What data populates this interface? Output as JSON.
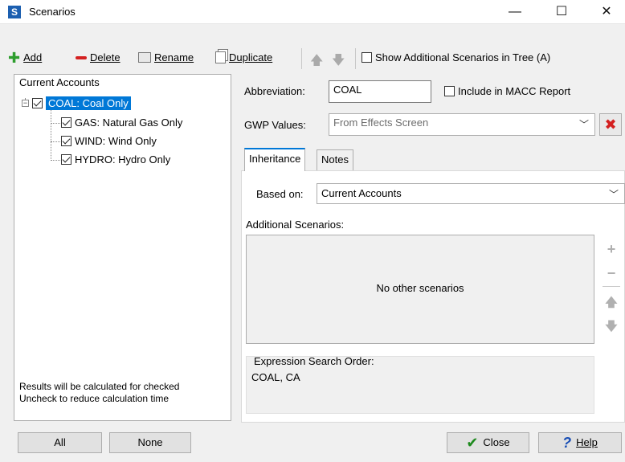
{
  "window": {
    "title": "Scenarios",
    "app_icon_letter": "S",
    "minimize": "—",
    "maximize": "☐",
    "close": "✕"
  },
  "toolbar": {
    "add": "Add",
    "delete": "Delete",
    "rename": "Rename",
    "duplicate": "Duplicate",
    "show_additional": "Show Additional Scenarios in Tree (A)"
  },
  "tree": {
    "root": "Current Accounts",
    "selected": "COAL: Coal Only",
    "children": [
      "GAS: Natural Gas Only",
      "WIND: Wind Only",
      "HYDRO: Hydro Only"
    ],
    "note_line1": "Results will be calculated for checked",
    "note_line2": "Uncheck to reduce calculation time"
  },
  "form": {
    "abbreviation_label": "Abbreviation:",
    "abbreviation_value": "COAL",
    "include_macc": "Include in MACC Report",
    "gwp_label": "GWP Values:",
    "gwp_value": "From Effects Screen"
  },
  "tabs": [
    "Inheritance",
    "Notes"
  ],
  "inheritance": {
    "based_on_label": "Based on:",
    "based_on_value": "Current Accounts",
    "additional_label": "Additional Scenarios:",
    "empty_text": "No other scenarios",
    "expr_label": "Expression Search Order:",
    "expr_value": "COAL, CA"
  },
  "buttons": {
    "all": "All",
    "none": "None",
    "close": "Close",
    "help": "Help"
  },
  "colors": {
    "selection": "#0078d7",
    "add_icon": "#2e9e2e",
    "delete_icon": "#d42020"
  }
}
